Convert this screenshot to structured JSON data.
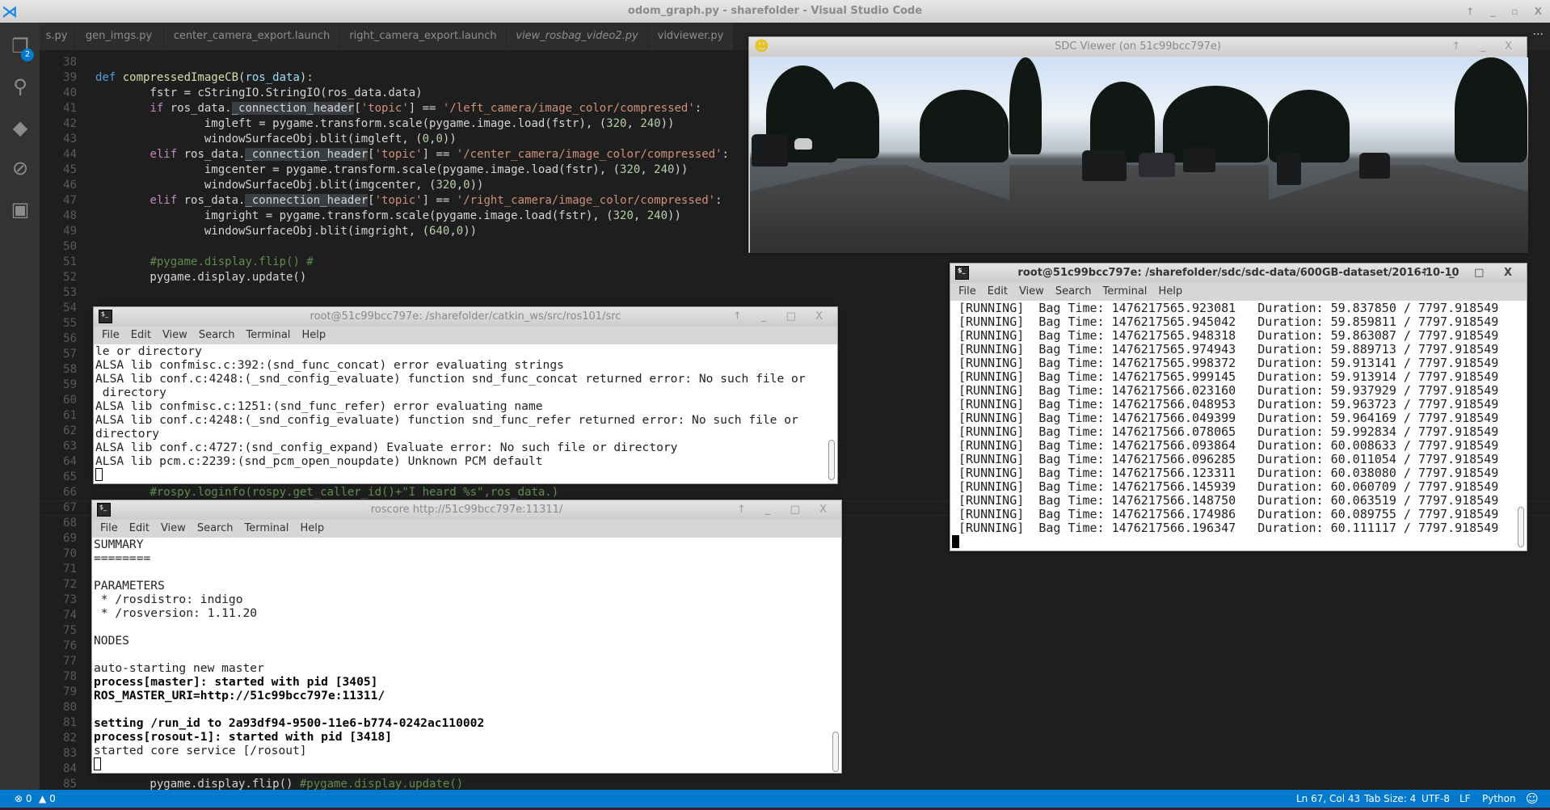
{
  "window": {
    "title": "odom_graph.py - sharefolder - Visual Studio Code",
    "controls": "↑ _ ▫ X"
  },
  "activity_bar": {
    "explorer_badge": "2"
  },
  "tabs": [
    {
      "label": "s.py",
      "italic": false
    },
    {
      "label": "gen_imgs.py",
      "italic": false
    },
    {
      "label": "center_camera_export.launch",
      "italic": false
    },
    {
      "label": "right_camera_export.launch",
      "italic": false
    },
    {
      "label": "view_rosbag_video2.py",
      "italic": true
    },
    {
      "label": "vidviewer.py",
      "italic": false
    }
  ],
  "tabs_more": "···",
  "editor": {
    "line_numbers": [
      38,
      39,
      40,
      41,
      42,
      43,
      44,
      45,
      46,
      47,
      48,
      49,
      50,
      51,
      52,
      53,
      54,
      55,
      56,
      57,
      58,
      59,
      60,
      61,
      62,
      63,
      64,
      65,
      66,
      67,
      68,
      69,
      70,
      71,
      72,
      73,
      74,
      75,
      76,
      77,
      78,
      79,
      80,
      81,
      82,
      83,
      84,
      85
    ],
    "lines": [
      {
        "n": 39,
        "tokens": [
          [
            "def ",
            "kw"
          ],
          [
            "compressedImageCB",
            "fn"
          ],
          [
            "(",
            ""
          ],
          [
            "ros_data",
            "pm"
          ],
          [
            "):",
            ""
          ]
        ]
      },
      {
        "n": 40,
        "tokens": [
          [
            "        fstr = cStringIO.StringIO(ros_data.data)",
            ""
          ]
        ]
      },
      {
        "n": 41,
        "tokens": [
          [
            "        ",
            ""
          ],
          [
            "if",
            "ctl"
          ],
          [
            " ros_data.",
            ""
          ],
          [
            "_connection_header",
            "hl"
          ],
          [
            "[",
            ""
          ],
          [
            "'topic'",
            "str"
          ],
          [
            "] == ",
            ""
          ],
          [
            "'/left_camera/image_color/compressed'",
            "str"
          ],
          [
            ":",
            ""
          ]
        ]
      },
      {
        "n": 42,
        "tokens": [
          [
            "                imgleft = pygame.transform.scale(pygame.image.load(fstr), (",
            ""
          ],
          [
            "320",
            "num"
          ],
          [
            ", ",
            ""
          ],
          [
            "240",
            "num"
          ],
          [
            "))",
            ""
          ]
        ]
      },
      {
        "n": 43,
        "tokens": [
          [
            "                windowSurfaceObj.blit(imgleft, (",
            ""
          ],
          [
            "0",
            "num"
          ],
          [
            ",",
            ""
          ],
          [
            "0",
            "num"
          ],
          [
            "))",
            ""
          ]
        ]
      },
      {
        "n": 44,
        "tokens": [
          [
            "        ",
            ""
          ],
          [
            "elif",
            "ctl"
          ],
          [
            " ros_data.",
            ""
          ],
          [
            "_connection_header",
            "hl"
          ],
          [
            "[",
            ""
          ],
          [
            "'topic'",
            "str"
          ],
          [
            "] == ",
            ""
          ],
          [
            "'/center_camera/image_color/compressed'",
            "str"
          ],
          [
            ":",
            ""
          ]
        ]
      },
      {
        "n": 45,
        "tokens": [
          [
            "                imgcenter = pygame.transform.scale(pygame.image.load(fstr), (",
            ""
          ],
          [
            "320",
            "num"
          ],
          [
            ", ",
            ""
          ],
          [
            "240",
            "num"
          ],
          [
            "))",
            ""
          ]
        ]
      },
      {
        "n": 46,
        "tokens": [
          [
            "                windowSurfaceObj.blit(imgcenter, (",
            ""
          ],
          [
            "320",
            "num"
          ],
          [
            ",",
            ""
          ],
          [
            "0",
            "num"
          ],
          [
            "))",
            ""
          ]
        ]
      },
      {
        "n": 47,
        "tokens": [
          [
            "        ",
            ""
          ],
          [
            "elif",
            "ctl"
          ],
          [
            " ros_data.",
            ""
          ],
          [
            "_connection_header",
            "hl"
          ],
          [
            "[",
            ""
          ],
          [
            "'topic'",
            "str"
          ],
          [
            "] == ",
            ""
          ],
          [
            "'/right_camera/image_color/compressed'",
            "str"
          ],
          [
            ":",
            ""
          ]
        ]
      },
      {
        "n": 48,
        "tokens": [
          [
            "                imgright = pygame.transform.scale(pygame.image.load(fstr), (",
            ""
          ],
          [
            "320",
            "num"
          ],
          [
            ", ",
            ""
          ],
          [
            "240",
            "num"
          ],
          [
            "))",
            ""
          ]
        ]
      },
      {
        "n": 49,
        "tokens": [
          [
            "                windowSurfaceObj.blit(imgright, (",
            ""
          ],
          [
            "640",
            "num"
          ],
          [
            ",",
            ""
          ],
          [
            "0",
            "num"
          ],
          [
            "))",
            ""
          ]
        ]
      },
      {
        "n": 51,
        "tokens": [
          [
            "        ",
            ""
          ],
          [
            "#pygame.display.flip() #",
            "cm"
          ]
        ]
      },
      {
        "n": 52,
        "tokens": [
          [
            "        pygame.display.update()",
            ""
          ]
        ]
      },
      {
        "n": 66,
        "tokens": [
          [
            "        ",
            ""
          ],
          [
            "#rospy.loginfo(rospy.get_caller_id()+\"I heard %s\",ros_data.)",
            "cm"
          ]
        ]
      },
      {
        "n": 85,
        "tokens": [
          [
            "        pygame.display.flip() ",
            ""
          ],
          [
            "#pygame.display.update()",
            "cm"
          ]
        ]
      }
    ]
  },
  "sdc_viewer": {
    "title": "SDC Viewer (on 51c99bcc797e)",
    "controls": "↑ _ X"
  },
  "menu": [
    "File",
    "Edit",
    "View",
    "Search",
    "Terminal",
    "Help"
  ],
  "terminal_ros101": {
    "title": "root@51c99bcc797e: /sharefolder/catkin_ws/src/ros101/src",
    "controls": "↑ _ □ X",
    "lines": [
      "le or directory",
      "ALSA lib confmisc.c:392:(snd_func_concat) error evaluating strings",
      "ALSA lib conf.c:4248:(_snd_config_evaluate) function snd_func_concat returned error: No such file or",
      " directory",
      "ALSA lib confmisc.c:1251:(snd_func_refer) error evaluating name",
      "ALSA lib conf.c:4248:(_snd_config_evaluate) function snd_func_refer returned error: No such file or",
      "directory",
      "ALSA lib conf.c:4727:(snd_config_expand) Evaluate error: No such file or directory",
      "ALSA lib pcm.c:2239:(snd_pcm_open_noupdate) Unknown PCM default"
    ]
  },
  "terminal_roscore": {
    "title": "roscore http://51c99bcc797e:11311/",
    "controls": "↑ _ □ X",
    "lines": [
      {
        "text": "SUMMARY",
        "bold": false
      },
      {
        "text": "========",
        "bold": false
      },
      {
        "text": "",
        "bold": false
      },
      {
        "text": "PARAMETERS",
        "bold": false
      },
      {
        "text": " * /rosdistro: indigo",
        "bold": false
      },
      {
        "text": " * /rosversion: 1.11.20",
        "bold": false
      },
      {
        "text": "",
        "bold": false
      },
      {
        "text": "NODES",
        "bold": false
      },
      {
        "text": "",
        "bold": false
      },
      {
        "text": "auto-starting new master",
        "bold": false
      },
      {
        "text": "process[master]: started with pid [3405]",
        "bold": true
      },
      {
        "text": "ROS_MASTER_URI=http://51c99bcc797e:11311/",
        "bold": true
      },
      {
        "text": "",
        "bold": false
      },
      {
        "text": "setting /run_id to 2a93df94-9500-11e6-b774-0242ac110002",
        "bold": true
      },
      {
        "text": "process[rosout-1]: started with pid [3418]",
        "bold": true
      },
      {
        "text": "started core service [/rosout]",
        "bold": false
      }
    ]
  },
  "terminal_rosbag": {
    "title": "root@51c99bcc797e: /sharefolder/sdc/sdc-data/600GB-dataset/2016-10-10",
    "controls": "↑ _ □ X",
    "status": "[RUNNING]",
    "total_duration": "7797.918549",
    "rows": [
      [
        "1476217565.923081",
        "59.837850"
      ],
      [
        "1476217565.945042",
        "59.859811"
      ],
      [
        "1476217565.948318",
        "59.863087"
      ],
      [
        "1476217565.974943",
        "59.889713"
      ],
      [
        "1476217565.998372",
        "59.913141"
      ],
      [
        "1476217565.999145",
        "59.913914"
      ],
      [
        "1476217566.023160",
        "59.937929"
      ],
      [
        "1476217566.048953",
        "59.963723"
      ],
      [
        "1476217566.049399",
        "59.964169"
      ],
      [
        "1476217566.078065",
        "59.992834"
      ],
      [
        "1476217566.093864",
        "60.008633"
      ],
      [
        "1476217566.096285",
        "60.011054"
      ],
      [
        "1476217566.123311",
        "60.038080"
      ],
      [
        "1476217566.145939",
        "60.060709"
      ],
      [
        "1476217566.148750",
        "60.063519"
      ],
      [
        "1476217566.174986",
        "60.089755"
      ],
      [
        "1476217566.196347",
        "60.111117"
      ]
    ]
  },
  "statusbar": {
    "errors": "0",
    "warnings": "0",
    "position": "Ln 67, Col 43",
    "tab_size": "Tab Size: 4",
    "encoding": "UTF-8",
    "eol": "LF",
    "language": "Python",
    "color": "#007acc"
  }
}
